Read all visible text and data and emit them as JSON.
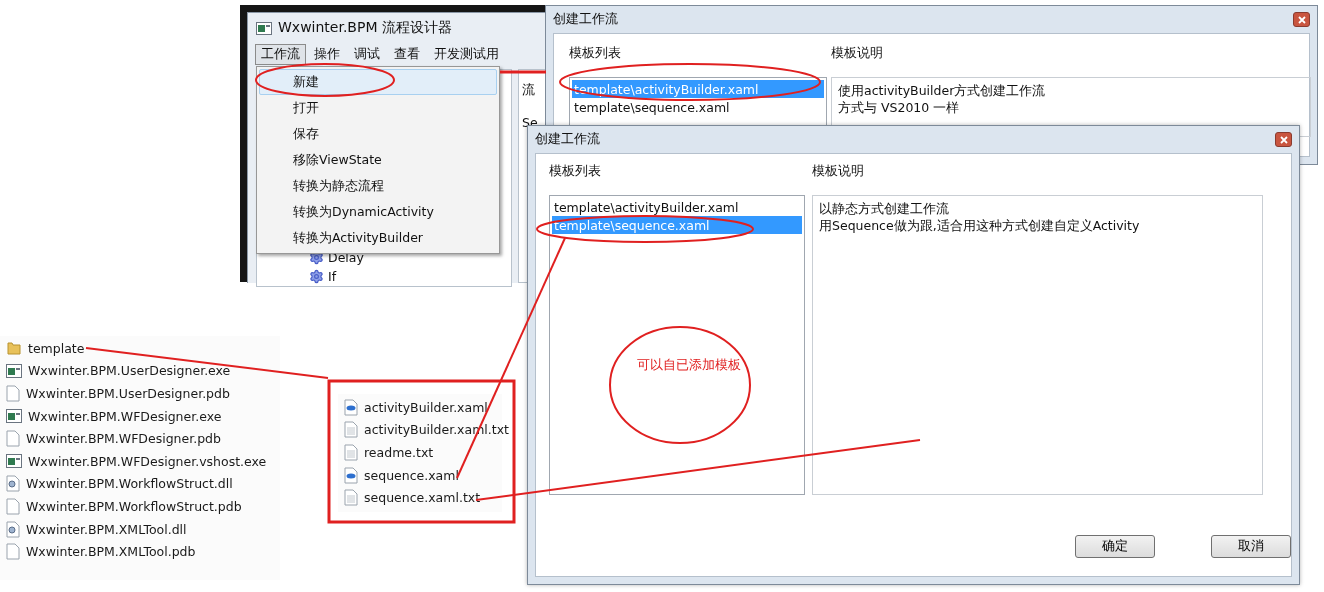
{
  "designer_window": {
    "title": "Wxwinter.BPM 流程设计器",
    "menu": [
      {
        "label": "工作流",
        "selected": true
      },
      {
        "label": "操作",
        "selected": false
      },
      {
        "label": "调试",
        "selected": false
      },
      {
        "label": "查看",
        "selected": false
      },
      {
        "label": "开发测试用",
        "selected": false
      }
    ],
    "dropdown": [
      {
        "label": "新建",
        "selected": true
      },
      {
        "label": "打开",
        "selected": false
      },
      {
        "label": "保存",
        "selected": false
      },
      {
        "label": "移除ViewState",
        "selected": false
      },
      {
        "label": "转换为静态流程",
        "selected": false
      },
      {
        "label": "转换为DynamicActivity",
        "selected": false
      },
      {
        "label": "转换为ActivityBuilder",
        "selected": false
      }
    ],
    "side_labels": [
      "流",
      "Se"
    ],
    "tree_items": [
      "Delay",
      "If"
    ]
  },
  "dialog_back": {
    "title": "创建工作流",
    "list_label": "模板列表",
    "description_label": "模板说明",
    "templates": [
      {
        "label": "template\\activityBuilder.xaml",
        "selected": true
      },
      {
        "label": "template\\sequence.xaml",
        "selected": false
      }
    ],
    "description": [
      "使用activityBuilder方式创建工作流",
      "方式与 VS2010  一样"
    ]
  },
  "dialog_front": {
    "title": "创建工作流",
    "list_label": "模板列表",
    "description_label": "模板说明",
    "templates": [
      {
        "label": "template\\activityBuilder.xaml",
        "selected": false
      },
      {
        "label": "template\\sequence.xaml",
        "selected": true
      }
    ],
    "description": [
      "以静态方式创建工作流",
      "用Sequence做为跟,适合用这种方式创建自定义Activity"
    ],
    "buttons": [
      "确定",
      "取消"
    ]
  },
  "file_list": [
    {
      "name": "template",
      "kind": "folder"
    },
    {
      "name": "Wxwinter.BPM.UserDesigner.exe",
      "kind": "exe"
    },
    {
      "name": "Wxwinter.BPM.UserDesigner.pdb",
      "kind": "file"
    },
    {
      "name": "Wxwinter.BPM.WFDesigner.exe",
      "kind": "exe"
    },
    {
      "name": "Wxwinter.BPM.WFDesigner.pdb",
      "kind": "file"
    },
    {
      "name": "Wxwinter.BPM.WFDesigner.vshost.exe",
      "kind": "exe"
    },
    {
      "name": "Wxwinter.BPM.WorkflowStruct.dll",
      "kind": "dll"
    },
    {
      "name": "Wxwinter.BPM.WorkflowStruct.pdb",
      "kind": "file"
    },
    {
      "name": "Wxwinter.BPM.XMLTool.dll",
      "kind": "dll"
    },
    {
      "name": "Wxwinter.BPM.XMLTool.pdb",
      "kind": "file"
    }
  ],
  "template_folder": [
    {
      "name": "activityBuilder.xaml",
      "kind": "xaml"
    },
    {
      "name": "activityBuilder.xaml.txt",
      "kind": "txt"
    },
    {
      "name": "readme.txt",
      "kind": "txt"
    },
    {
      "name": "sequence.xaml",
      "kind": "xaml"
    },
    {
      "name": "sequence.xaml.txt",
      "kind": "txt"
    }
  ],
  "annotation": {
    "note": "可以自已添加模板"
  }
}
